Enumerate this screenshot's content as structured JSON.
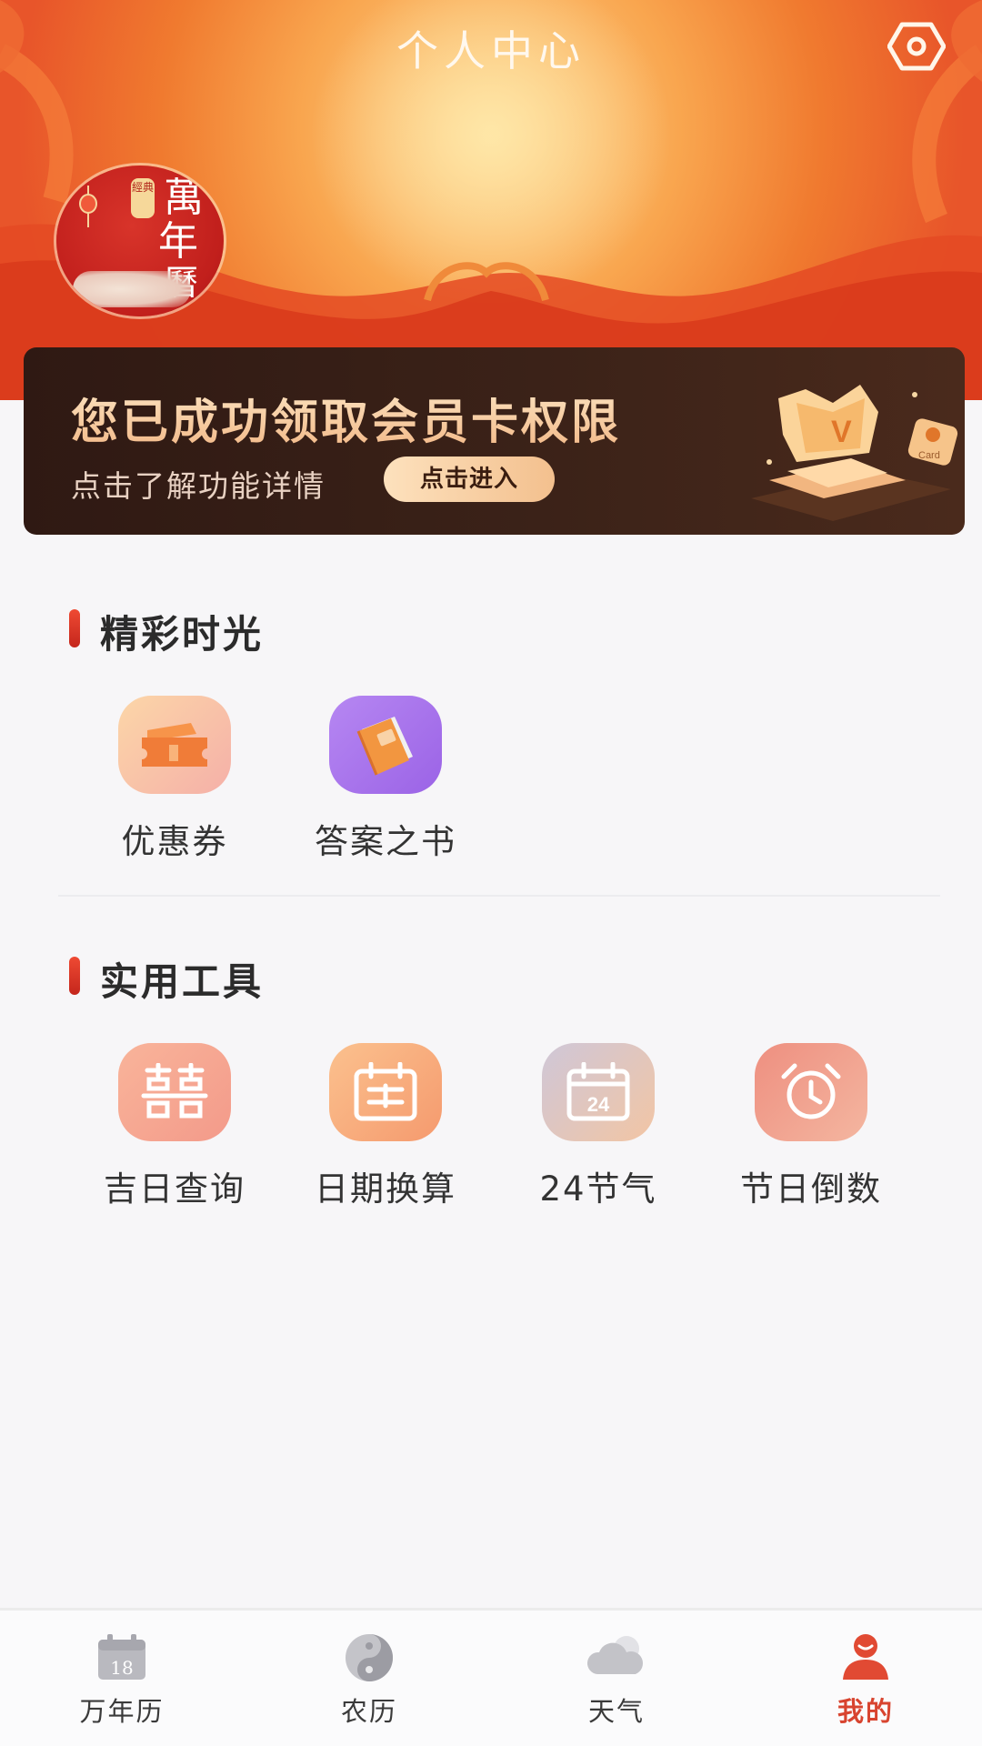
{
  "header": {
    "title": "个人中心",
    "settings_icon": "settings-hexagon-icon",
    "avatar": {
      "text_chars": [
        "萬",
        "年",
        "曆"
      ],
      "seal_text": "經典"
    }
  },
  "member_card": {
    "title": "您已成功领取会员卡权限",
    "subtitle": "点击了解功能详情",
    "button_label": "点击进入",
    "art_badge": "Card"
  },
  "sections": [
    {
      "title": "精彩时光",
      "items": [
        {
          "label": "优惠券",
          "icon": "coupon-icon"
        },
        {
          "label": "答案之书",
          "icon": "answer-book-icon"
        }
      ]
    },
    {
      "title": "实用工具",
      "items": [
        {
          "label": "吉日查询",
          "icon": "double-happiness-icon"
        },
        {
          "label": "日期换算",
          "icon": "calendar-convert-icon"
        },
        {
          "label": "24节气",
          "icon": "calendar-24-icon",
          "icon_text": "24"
        },
        {
          "label": "节日倒数",
          "icon": "alarm-clock-icon"
        }
      ]
    }
  ],
  "bottom_nav": {
    "items": [
      {
        "label": "万年历",
        "icon": "calendar-icon",
        "icon_text": "18",
        "active": false
      },
      {
        "label": "农历",
        "icon": "yin-yang-icon",
        "active": false
      },
      {
        "label": "天气",
        "icon": "cloud-icon",
        "active": false
      },
      {
        "label": "我的",
        "icon": "person-icon",
        "active": true
      }
    ]
  },
  "colors": {
    "accent": "#d8442f",
    "header_gradient": [
      "#fcd28e",
      "#e8552a"
    ],
    "card_bg": "#3b2218"
  }
}
